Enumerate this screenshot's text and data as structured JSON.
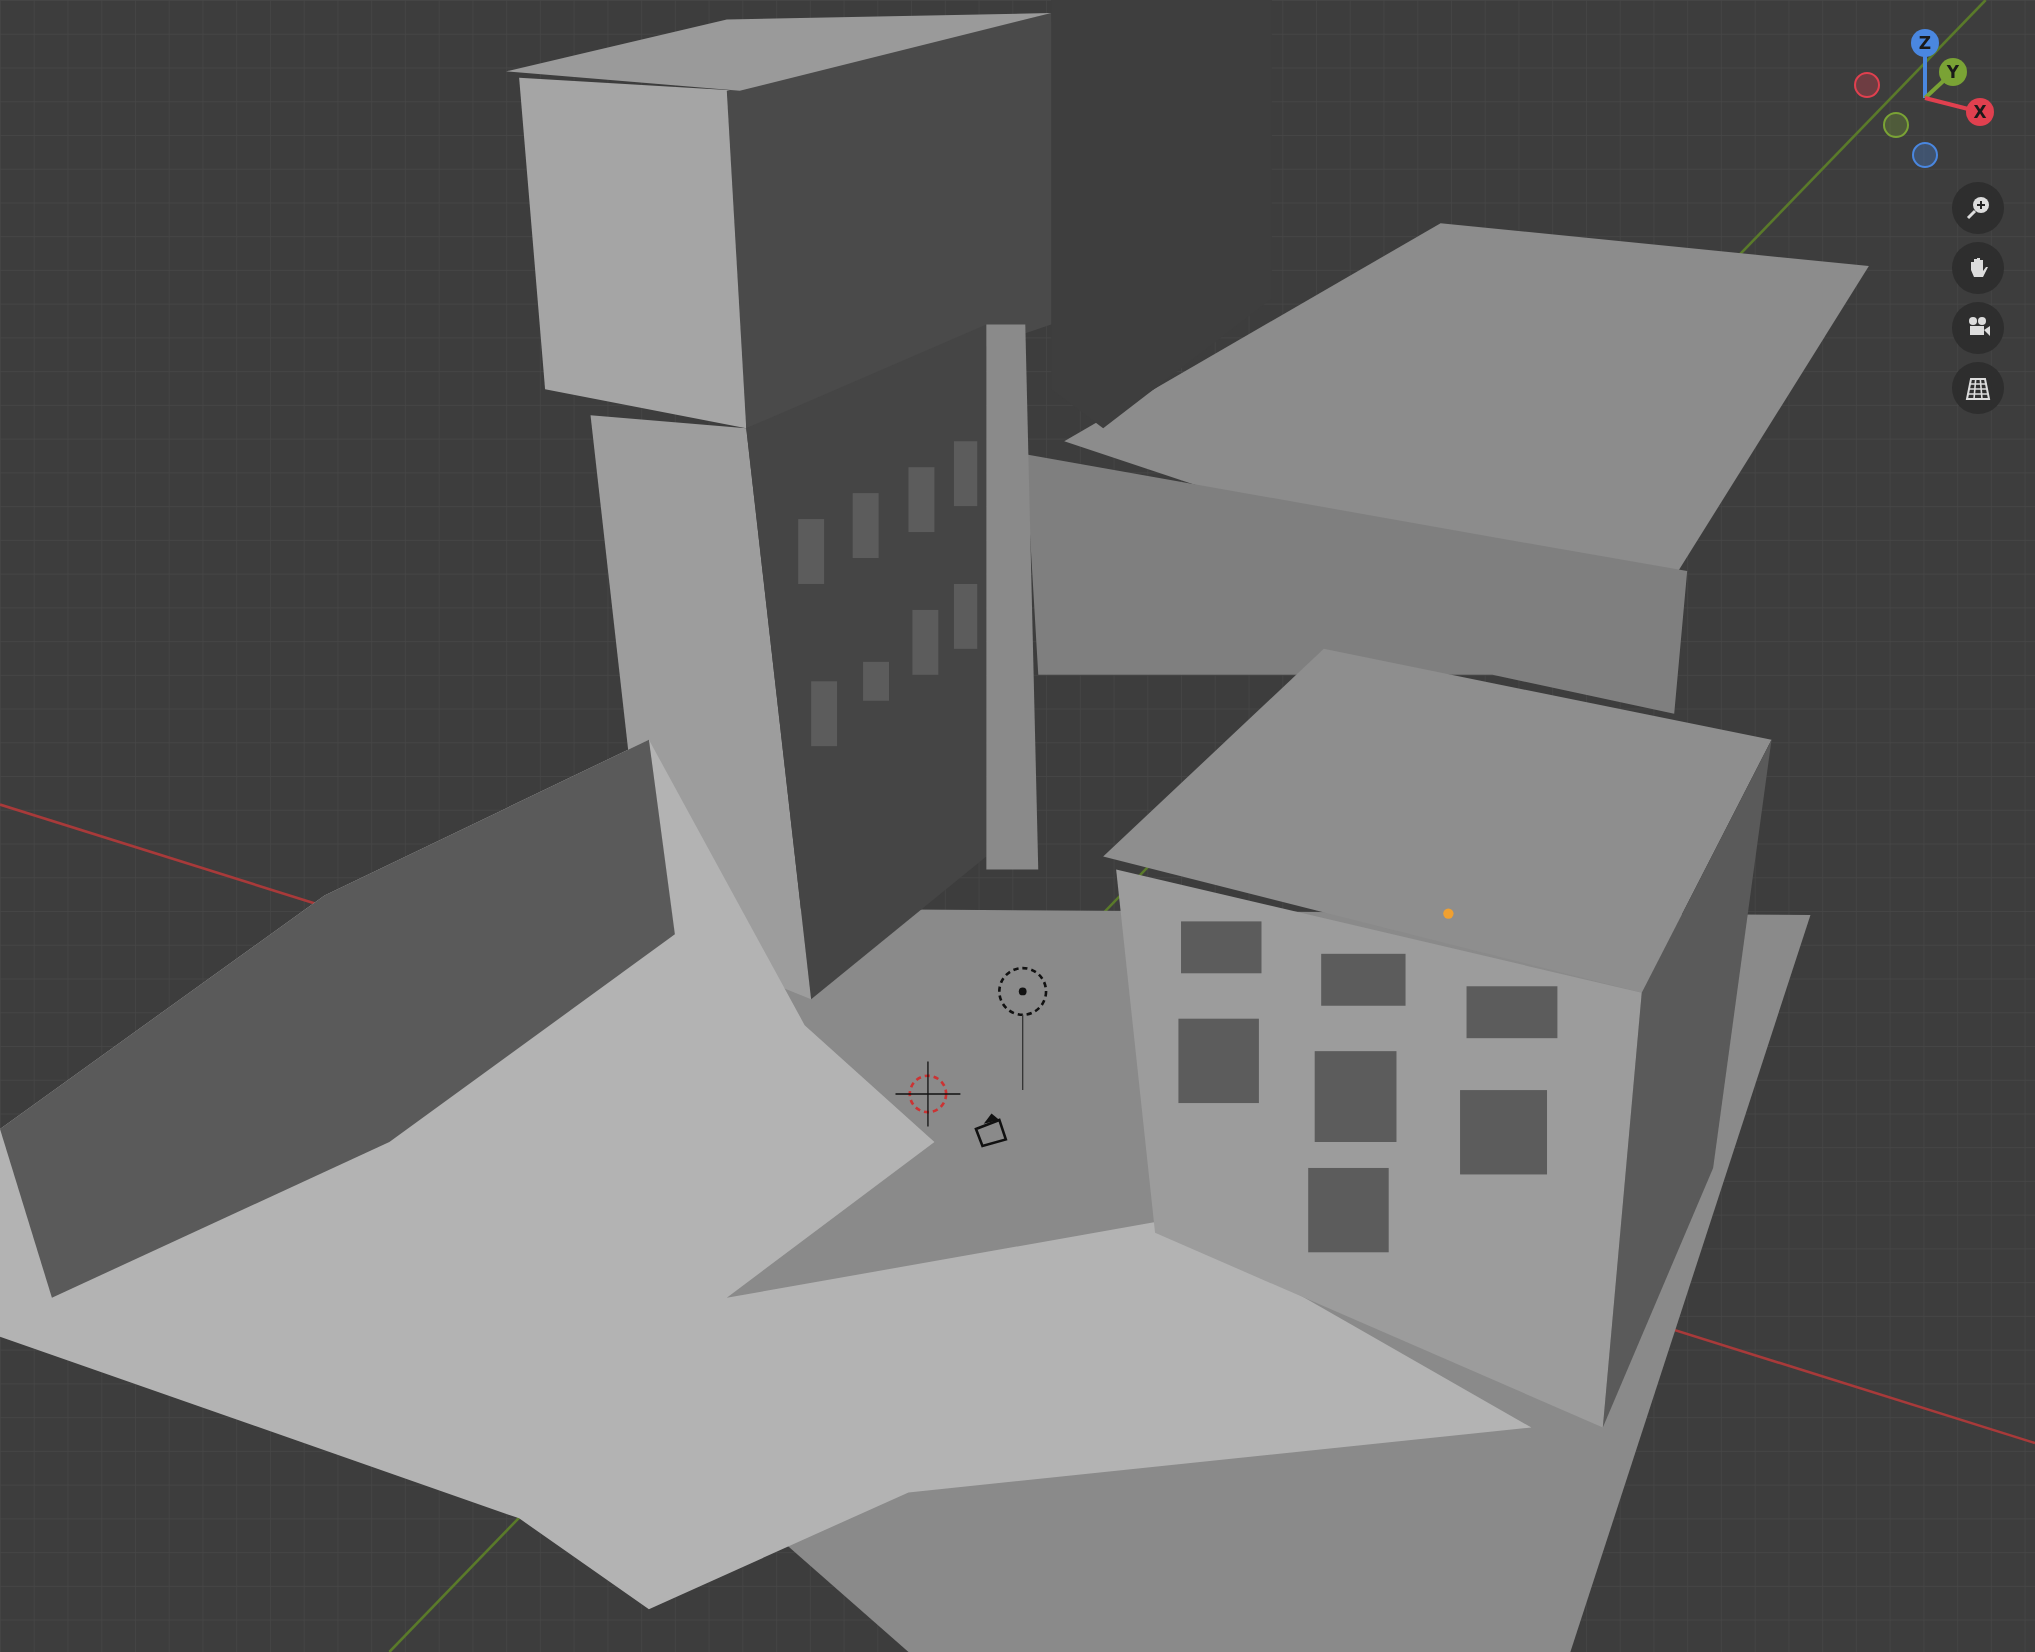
{
  "viewport": {
    "navigation_gizmo": {
      "axes": [
        {
          "label": "Z",
          "color": "#4a87e0"
        },
        {
          "label": "Y",
          "color": "#7aa335"
        },
        {
          "label": "X",
          "color": "#e0404f"
        }
      ]
    },
    "nav_buttons": [
      {
        "kind": "zoom"
      },
      {
        "kind": "pan"
      },
      {
        "kind": "camera"
      },
      {
        "kind": "grid"
      }
    ]
  }
}
